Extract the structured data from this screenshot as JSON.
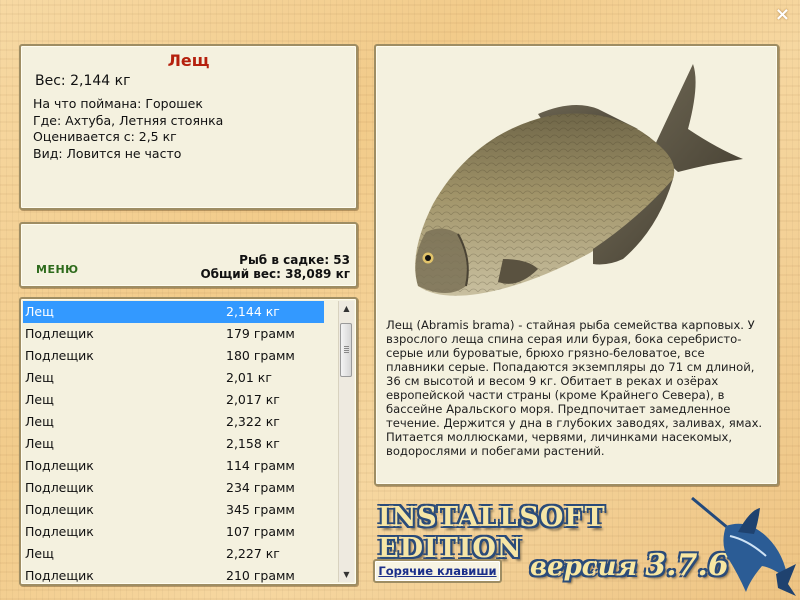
{
  "window": {
    "close_label": "×"
  },
  "fish_info": {
    "title": "Лещ",
    "weight": "Вес: 2,144 кг",
    "bait": "На что поймана: Горошек",
    "location": "Где: Ахтуба, Летняя стоянка",
    "rated_from": "Оценивается с: 2,5 кг",
    "species_note": "Вид: Ловится не часто"
  },
  "stats": {
    "menu_label": "МЕНЮ",
    "fish_in_keepnet": "Рыб в садке: 53",
    "total_weight": "Общий вес: 38,089 кг"
  },
  "catch_list": {
    "rows": [
      {
        "name": "Лещ",
        "weight": "2,144 кг",
        "selected": true
      },
      {
        "name": "Подлещик",
        "weight": "179 грамм"
      },
      {
        "name": "Подлещик",
        "weight": "180 грамм"
      },
      {
        "name": "Лещ",
        "weight": "2,01 кг"
      },
      {
        "name": "Лещ",
        "weight": "2,017 кг"
      },
      {
        "name": "Лещ",
        "weight": "2,322 кг"
      },
      {
        "name": "Лещ",
        "weight": "2,158 кг"
      },
      {
        "name": "Подлещик",
        "weight": "114 грамм"
      },
      {
        "name": "Подлещик",
        "weight": "234 грамм"
      },
      {
        "name": "Подлещик",
        "weight": "345 грамм"
      },
      {
        "name": "Подлещик",
        "weight": "107 грамм"
      },
      {
        "name": "Лещ",
        "weight": "2,227 кг"
      },
      {
        "name": "Подлещик",
        "weight": "210 грамм"
      }
    ],
    "scroll_position": 0.1
  },
  "description": {
    "text": "Лещ (Abramis brama) - стайная рыба семейства карповых. У взрослого леща спина серая или бурая, бока серебристо-серые или буроватые, брюхо грязно-беловатое, все плавники серые. Попадаются экземпляры до 71 см длиной, 36 см высотой и весом 9 кг. Обитает в реках и озёрах европейской части страны (кроме Крайнего Севера), в бассейне Аральского моря. Предпочитает замедленное течение. Держится у дна в глубоких заводях, заливах, ямах. Питается моллюсками, червями, личинками насекомых, водорослями и побегами растений.",
    "image_icon": "bream-fish-photo"
  },
  "branding": {
    "logo_text": "INSTALLSOFT EDITION",
    "version_word": "версия",
    "version_number": "3.7.6",
    "mascot_icon": "marlin-icon"
  },
  "hotkeys_label": "Горячие клавиши",
  "colors": {
    "title_red": "#b5200d",
    "menu_green": "#2e6b1c",
    "selection_blue": "#3399ff",
    "link_blue": "#1b2f8a"
  }
}
